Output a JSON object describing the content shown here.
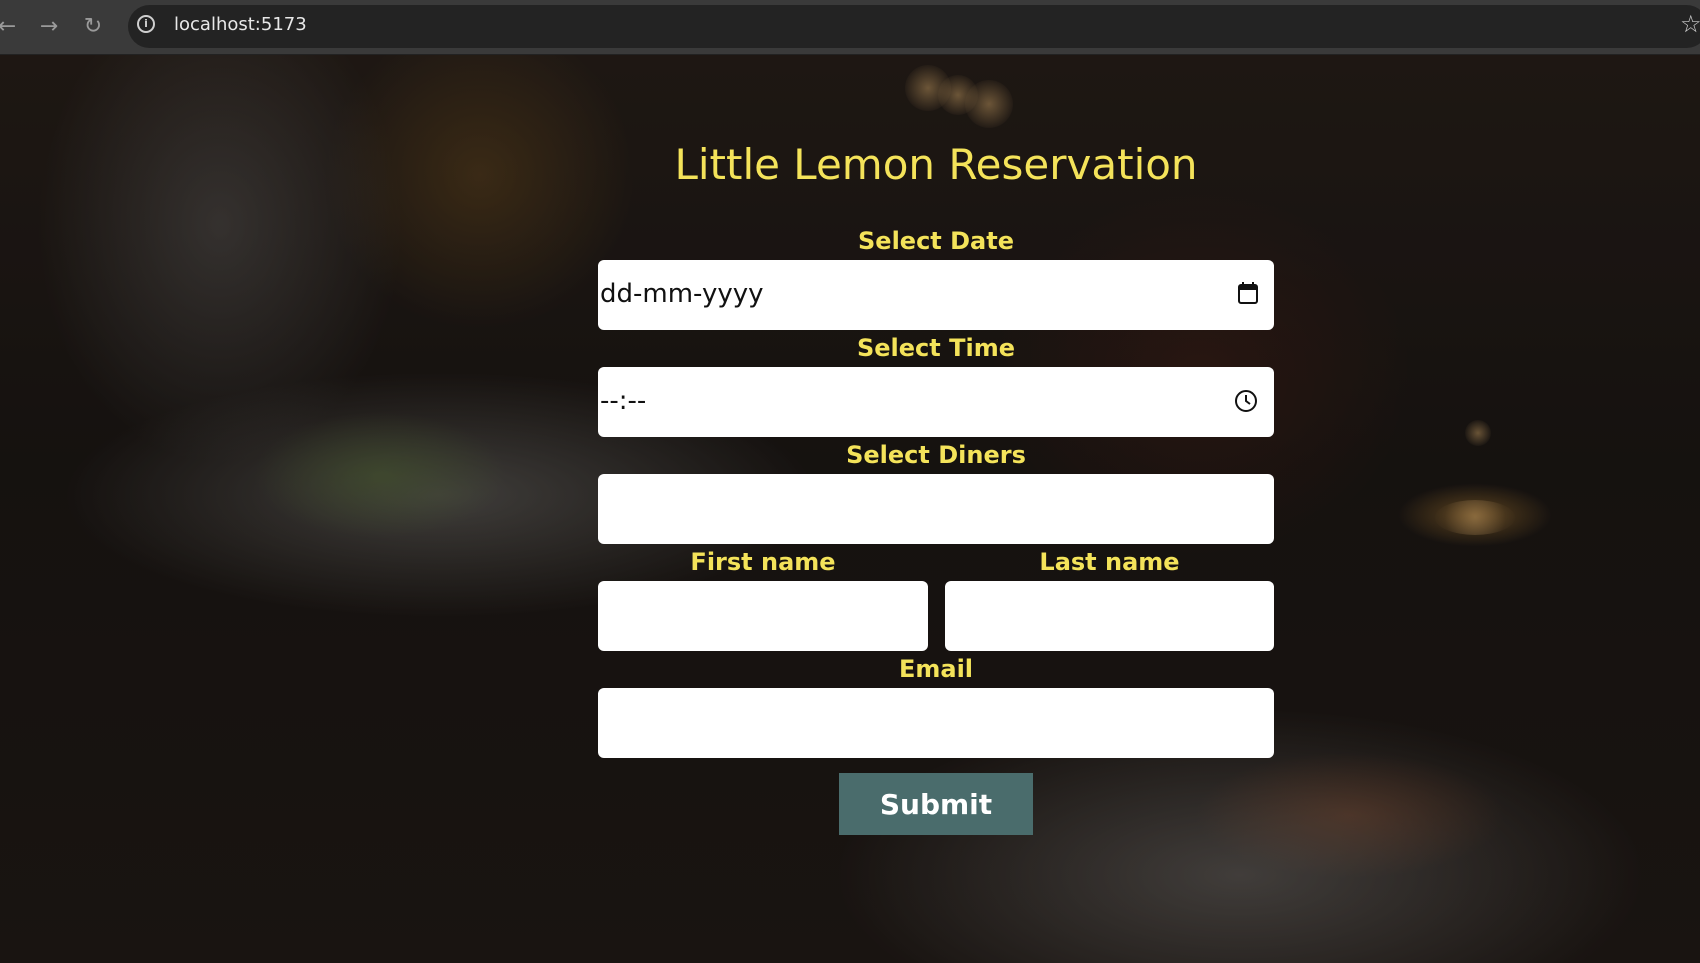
{
  "browser": {
    "back_icon": "arrow-left-icon",
    "forward_icon": "arrow-right-icon",
    "reload_icon": "reload-icon",
    "info_icon": "info-icon",
    "url": "localhost:5173",
    "bookmark_icon": "star-icon"
  },
  "page": {
    "title": "Little Lemon Reservation",
    "date": {
      "label": "Select Date",
      "placeholder": "dd-mm-yyyy",
      "icon": "calendar-icon"
    },
    "time": {
      "label": "Select Time",
      "placeholder": "--:--",
      "icon": "clock-icon"
    },
    "diners": {
      "label": "Select Diners",
      "value": ""
    },
    "first_name": {
      "label": "First name",
      "value": ""
    },
    "last_name": {
      "label": "Last name",
      "value": ""
    },
    "email": {
      "label": "Email",
      "value": ""
    },
    "submit_label": "Submit"
  },
  "colors": {
    "accent_yellow": "#f4e35a",
    "button_teal": "#4a6c6c",
    "field_white": "#ffffff"
  }
}
